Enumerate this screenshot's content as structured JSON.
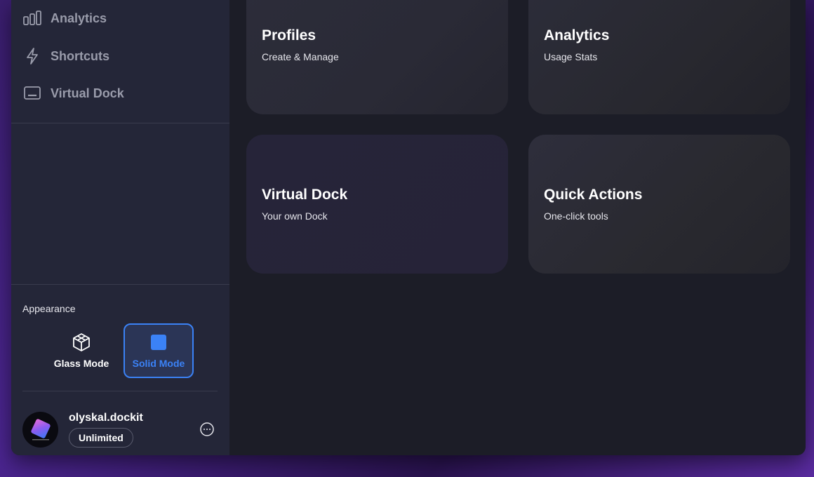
{
  "sidebar": {
    "nav": [
      {
        "label": "Analytics",
        "icon": "bar-chart-icon"
      },
      {
        "label": "Shortcuts",
        "icon": "lightning-icon"
      },
      {
        "label": "Virtual Dock",
        "icon": "dock-icon"
      }
    ],
    "appearance": {
      "label": "Appearance",
      "modes": [
        {
          "label": "Glass Mode",
          "icon": "cube-icon",
          "selected": false
        },
        {
          "label": "Solid Mode",
          "icon": "square-icon",
          "selected": true
        }
      ]
    },
    "user": {
      "name": "olyskal.dockit",
      "plan": "Unlimited"
    }
  },
  "cards": [
    {
      "title": "Profiles",
      "subtitle": "Create & Manage"
    },
    {
      "title": "Analytics",
      "subtitle": "Usage Stats"
    },
    {
      "title": "Virtual Dock",
      "subtitle": "Your own Dock"
    },
    {
      "title": "Quick Actions",
      "subtitle": "One-click tools"
    }
  ],
  "colors": {
    "accent": "#3b82f6",
    "sidebar_bg": "#242638",
    "main_bg": "#1c1d27"
  }
}
